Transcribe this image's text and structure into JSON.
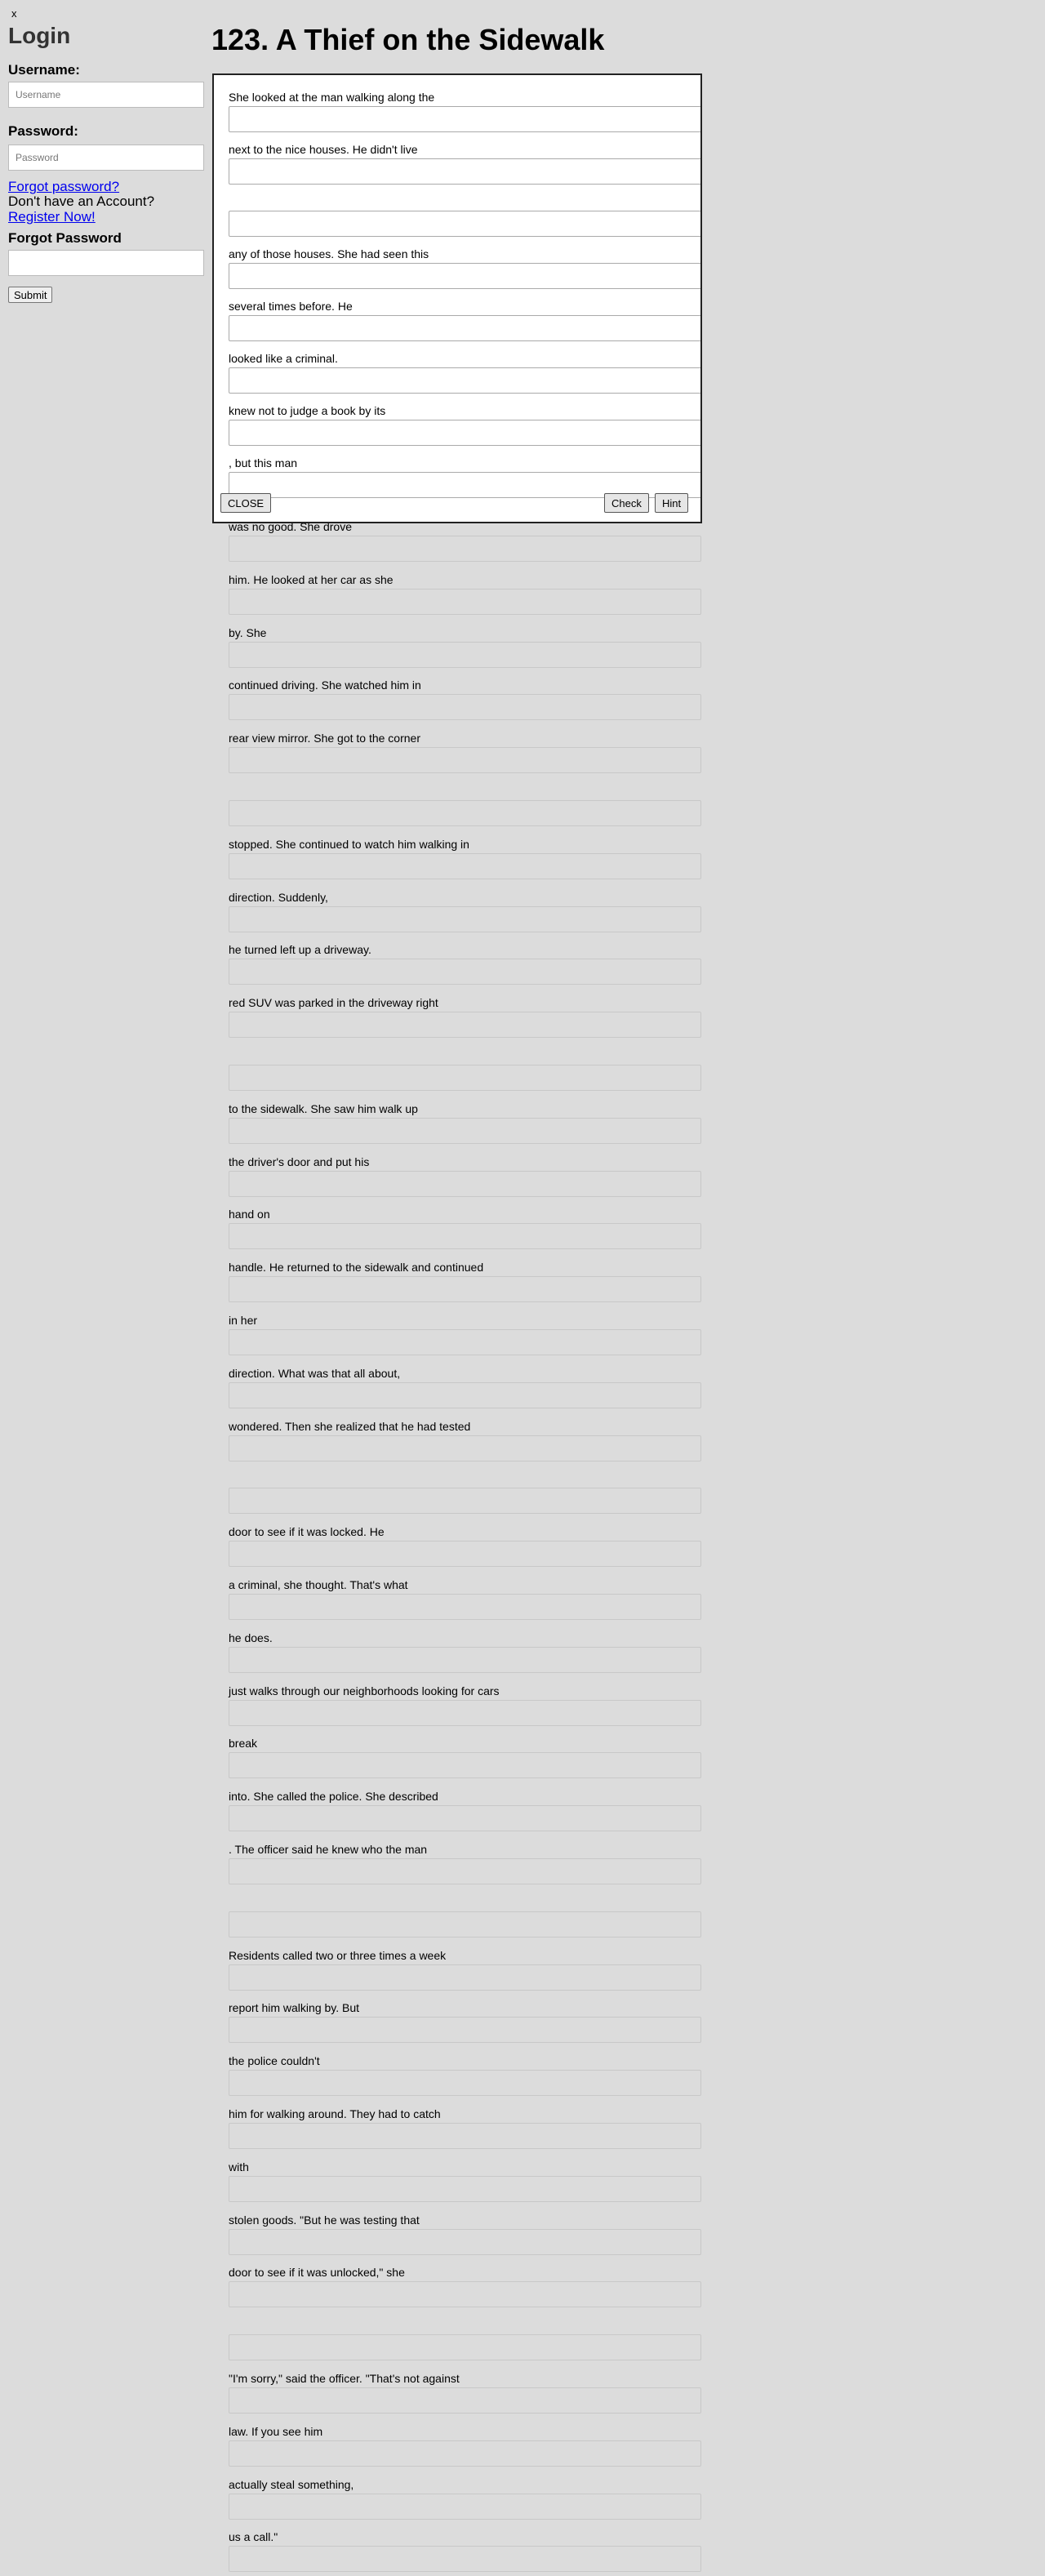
{
  "sidebar": {
    "close_label": "x",
    "login_title": "Login",
    "username_label": "Username:",
    "username_placeholder": "Username",
    "password_label": "Password:",
    "password_placeholder": "Password",
    "forgot_link": "Forgot password?",
    "no_account_text": "Don't have an Account?",
    "register_link": "Register Now!",
    "forgot_title": "Forgot Password",
    "submit_label": "Submit"
  },
  "story_title": "123. A Thief on the Sidewalk",
  "popup": {
    "close_label": "CLOSE",
    "check_label": "Check",
    "hint_label": "Hint",
    "segments": [
      "She looked at the man walking along the",
      "next to the nice houses. He didn't live",
      "",
      "any of those houses. She had seen this",
      "several times before. He",
      "looked like a criminal.",
      "knew not to judge a book by its",
      ", but this man"
    ]
  },
  "story": {
    "segments": [
      "was no good. She drove",
      "him. He looked at her car as she",
      "by. She",
      "continued driving. She watched him in",
      "rear view mirror. She got to the corner",
      "",
      "stopped. She continued to watch him walking in",
      "direction. Suddenly,",
      "he turned left up a driveway.",
      "red SUV was parked in the driveway right",
      "",
      "to the sidewalk. She saw him walk up",
      "the driver's door and put his",
      "hand on",
      "handle. He returned to the sidewalk and continued",
      "in her",
      "direction. What was that all about,",
      "wondered. Then she realized that he had tested",
      "",
      "door to see if it was locked. He",
      "a criminal, she thought. That's what",
      "he does.",
      "just walks through our neighborhoods looking for cars",
      "break",
      "into. She called the police. She described",
      ". The officer said he knew who the man",
      "",
      "Residents called two or three times a week",
      "report him walking by. But",
      "the police couldn't",
      "him for walking around. They had to catch",
      "with",
      "stolen goods. \"But he was testing that",
      "door to see if it was unlocked,\" she",
      "",
      "\"I'm sorry,\" said the officer. \"That's not against",
      "law. If you see him",
      "actually steal something,",
      "us a call.\""
    ]
  }
}
